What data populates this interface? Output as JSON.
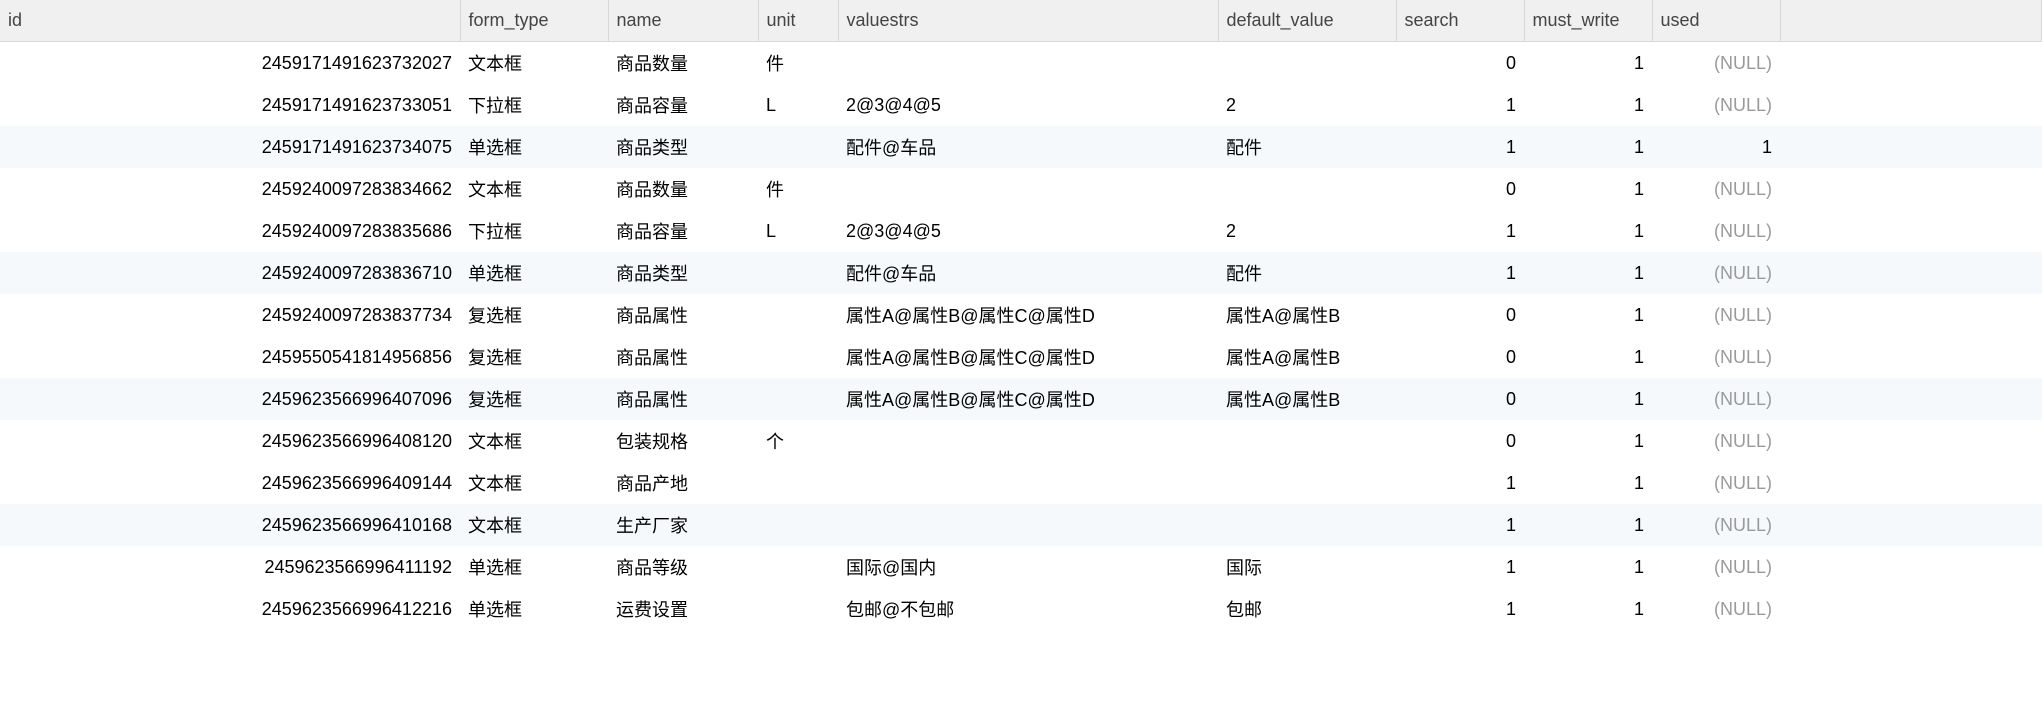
{
  "columns": {
    "id": "id",
    "form_type": "form_type",
    "name": "name",
    "unit": "unit",
    "valuestrs": "valuestrs",
    "default_value": "default_value",
    "search": "search",
    "must_write": "must_write",
    "used": "used"
  },
  "null_text": "(NULL)",
  "rows": [
    {
      "id": "2459171491623732027",
      "form_type": "文本框",
      "name": "商品数量",
      "unit": "件",
      "valuestrs": "",
      "default_value": "",
      "search": "0",
      "must_write": "1",
      "used": null,
      "alt": false
    },
    {
      "id": "2459171491623733051",
      "form_type": "下拉框",
      "name": "商品容量",
      "unit": "L",
      "valuestrs": "2@3@4@5",
      "default_value": "2",
      "search": "1",
      "must_write": "1",
      "used": null,
      "alt": false
    },
    {
      "id": "2459171491623734075",
      "form_type": "单选框",
      "name": "商品类型",
      "unit": "",
      "valuestrs": "配件@车品",
      "default_value": "配件",
      "search": "1",
      "must_write": "1",
      "used": "1",
      "alt": true
    },
    {
      "id": "2459240097283834662",
      "form_type": "文本框",
      "name": "商品数量",
      "unit": "件",
      "valuestrs": "",
      "default_value": "",
      "search": "0",
      "must_write": "1",
      "used": null,
      "alt": false
    },
    {
      "id": "2459240097283835686",
      "form_type": "下拉框",
      "name": "商品容量",
      "unit": "L",
      "valuestrs": "2@3@4@5",
      "default_value": "2",
      "search": "1",
      "must_write": "1",
      "used": null,
      "alt": false
    },
    {
      "id": "2459240097283836710",
      "form_type": "单选框",
      "name": "商品类型",
      "unit": "",
      "valuestrs": "配件@车品",
      "default_value": "配件",
      "search": "1",
      "must_write": "1",
      "used": null,
      "alt": true
    },
    {
      "id": "2459240097283837734",
      "form_type": "复选框",
      "name": "商品属性",
      "unit": "",
      "valuestrs": "属性A@属性B@属性C@属性D",
      "default_value": "属性A@属性B",
      "search": "0",
      "must_write": "1",
      "used": null,
      "alt": false
    },
    {
      "id": "2459550541814956856",
      "form_type": "复选框",
      "name": "商品属性",
      "unit": "",
      "valuestrs": "属性A@属性B@属性C@属性D",
      "default_value": "属性A@属性B",
      "search": "0",
      "must_write": "1",
      "used": null,
      "alt": false
    },
    {
      "id": "2459623566996407096",
      "form_type": "复选框",
      "name": "商品属性",
      "unit": "",
      "valuestrs": "属性A@属性B@属性C@属性D",
      "default_value": "属性A@属性B",
      "search": "0",
      "must_write": "1",
      "used": null,
      "alt": true
    },
    {
      "id": "2459623566996408120",
      "form_type": "文本框",
      "name": "包装规格",
      "unit": "个",
      "valuestrs": "",
      "default_value": "",
      "search": "0",
      "must_write": "1",
      "used": null,
      "alt": false
    },
    {
      "id": "2459623566996409144",
      "form_type": "文本框",
      "name": "商品产地",
      "unit": "",
      "valuestrs": "",
      "default_value": "",
      "search": "1",
      "must_write": "1",
      "used": null,
      "alt": false
    },
    {
      "id": "2459623566996410168",
      "form_type": "文本框",
      "name": "生产厂家",
      "unit": "",
      "valuestrs": "",
      "default_value": "",
      "search": "1",
      "must_write": "1",
      "used": null,
      "alt": true
    },
    {
      "id": "2459623566996411192",
      "form_type": "单选框",
      "name": "商品等级",
      "unit": "",
      "valuestrs": "国际@国内",
      "default_value": "国际",
      "search": "1",
      "must_write": "1",
      "used": null,
      "alt": false
    },
    {
      "id": "2459623566996412216",
      "form_type": "单选框",
      "name": "运费设置",
      "unit": "",
      "valuestrs": "包邮@不包邮",
      "default_value": "包邮",
      "search": "1",
      "must_write": "1",
      "used": null,
      "alt": false
    }
  ]
}
